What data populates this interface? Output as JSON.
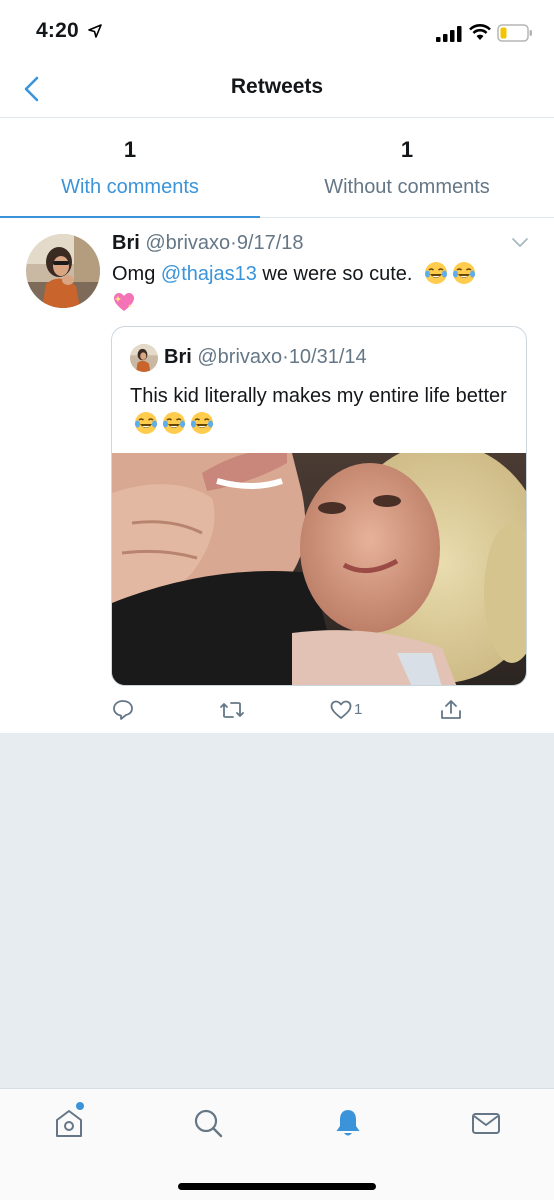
{
  "status_bar": {
    "time": "4:20",
    "icons": [
      "location-arrow-icon",
      "signal-icon",
      "wifi-icon",
      "battery-icon"
    ]
  },
  "nav": {
    "title": "Retweets",
    "back_icon": "chevron-left-icon"
  },
  "tabs": [
    {
      "count": "1",
      "label": "With comments",
      "active": true
    },
    {
      "count": "1",
      "label": "Without comments",
      "active": false
    }
  ],
  "tweet": {
    "name": "Bri",
    "handle": "@brivaxo",
    "separator": "·",
    "date": "9/17/18",
    "text_before": "Omg ",
    "mention": "@thajas13",
    "text_after": " we were so cute.",
    "emojis": [
      "tears-of-joy-emoji",
      "tears-of-joy-emoji",
      "sparkling-heart-emoji"
    ],
    "quoted": {
      "name": "Bri",
      "handle": "@brivaxo",
      "separator": "·",
      "date": "10/31/14",
      "text": "This kid literally  makes my entire life better",
      "emojis": [
        "tears-of-joy-emoji",
        "tears-of-joy-emoji",
        "tears-of-joy-emoji"
      ]
    },
    "actions": {
      "reply_icon": "reply-icon",
      "retweet_icon": "retweet-icon",
      "like_icon": "heart-icon",
      "like_count": "1",
      "share_icon": "share-icon"
    }
  },
  "tab_bar": {
    "items": [
      "home-icon",
      "search-icon",
      "notifications-bell-icon",
      "messages-envelope-icon"
    ],
    "active": "notifications-bell-icon"
  },
  "colors": {
    "accent": "#3b94d9",
    "text": "#14171a",
    "muted": "#657786",
    "divider": "#e1e8ed",
    "empty_background": "#e6ecf0"
  }
}
